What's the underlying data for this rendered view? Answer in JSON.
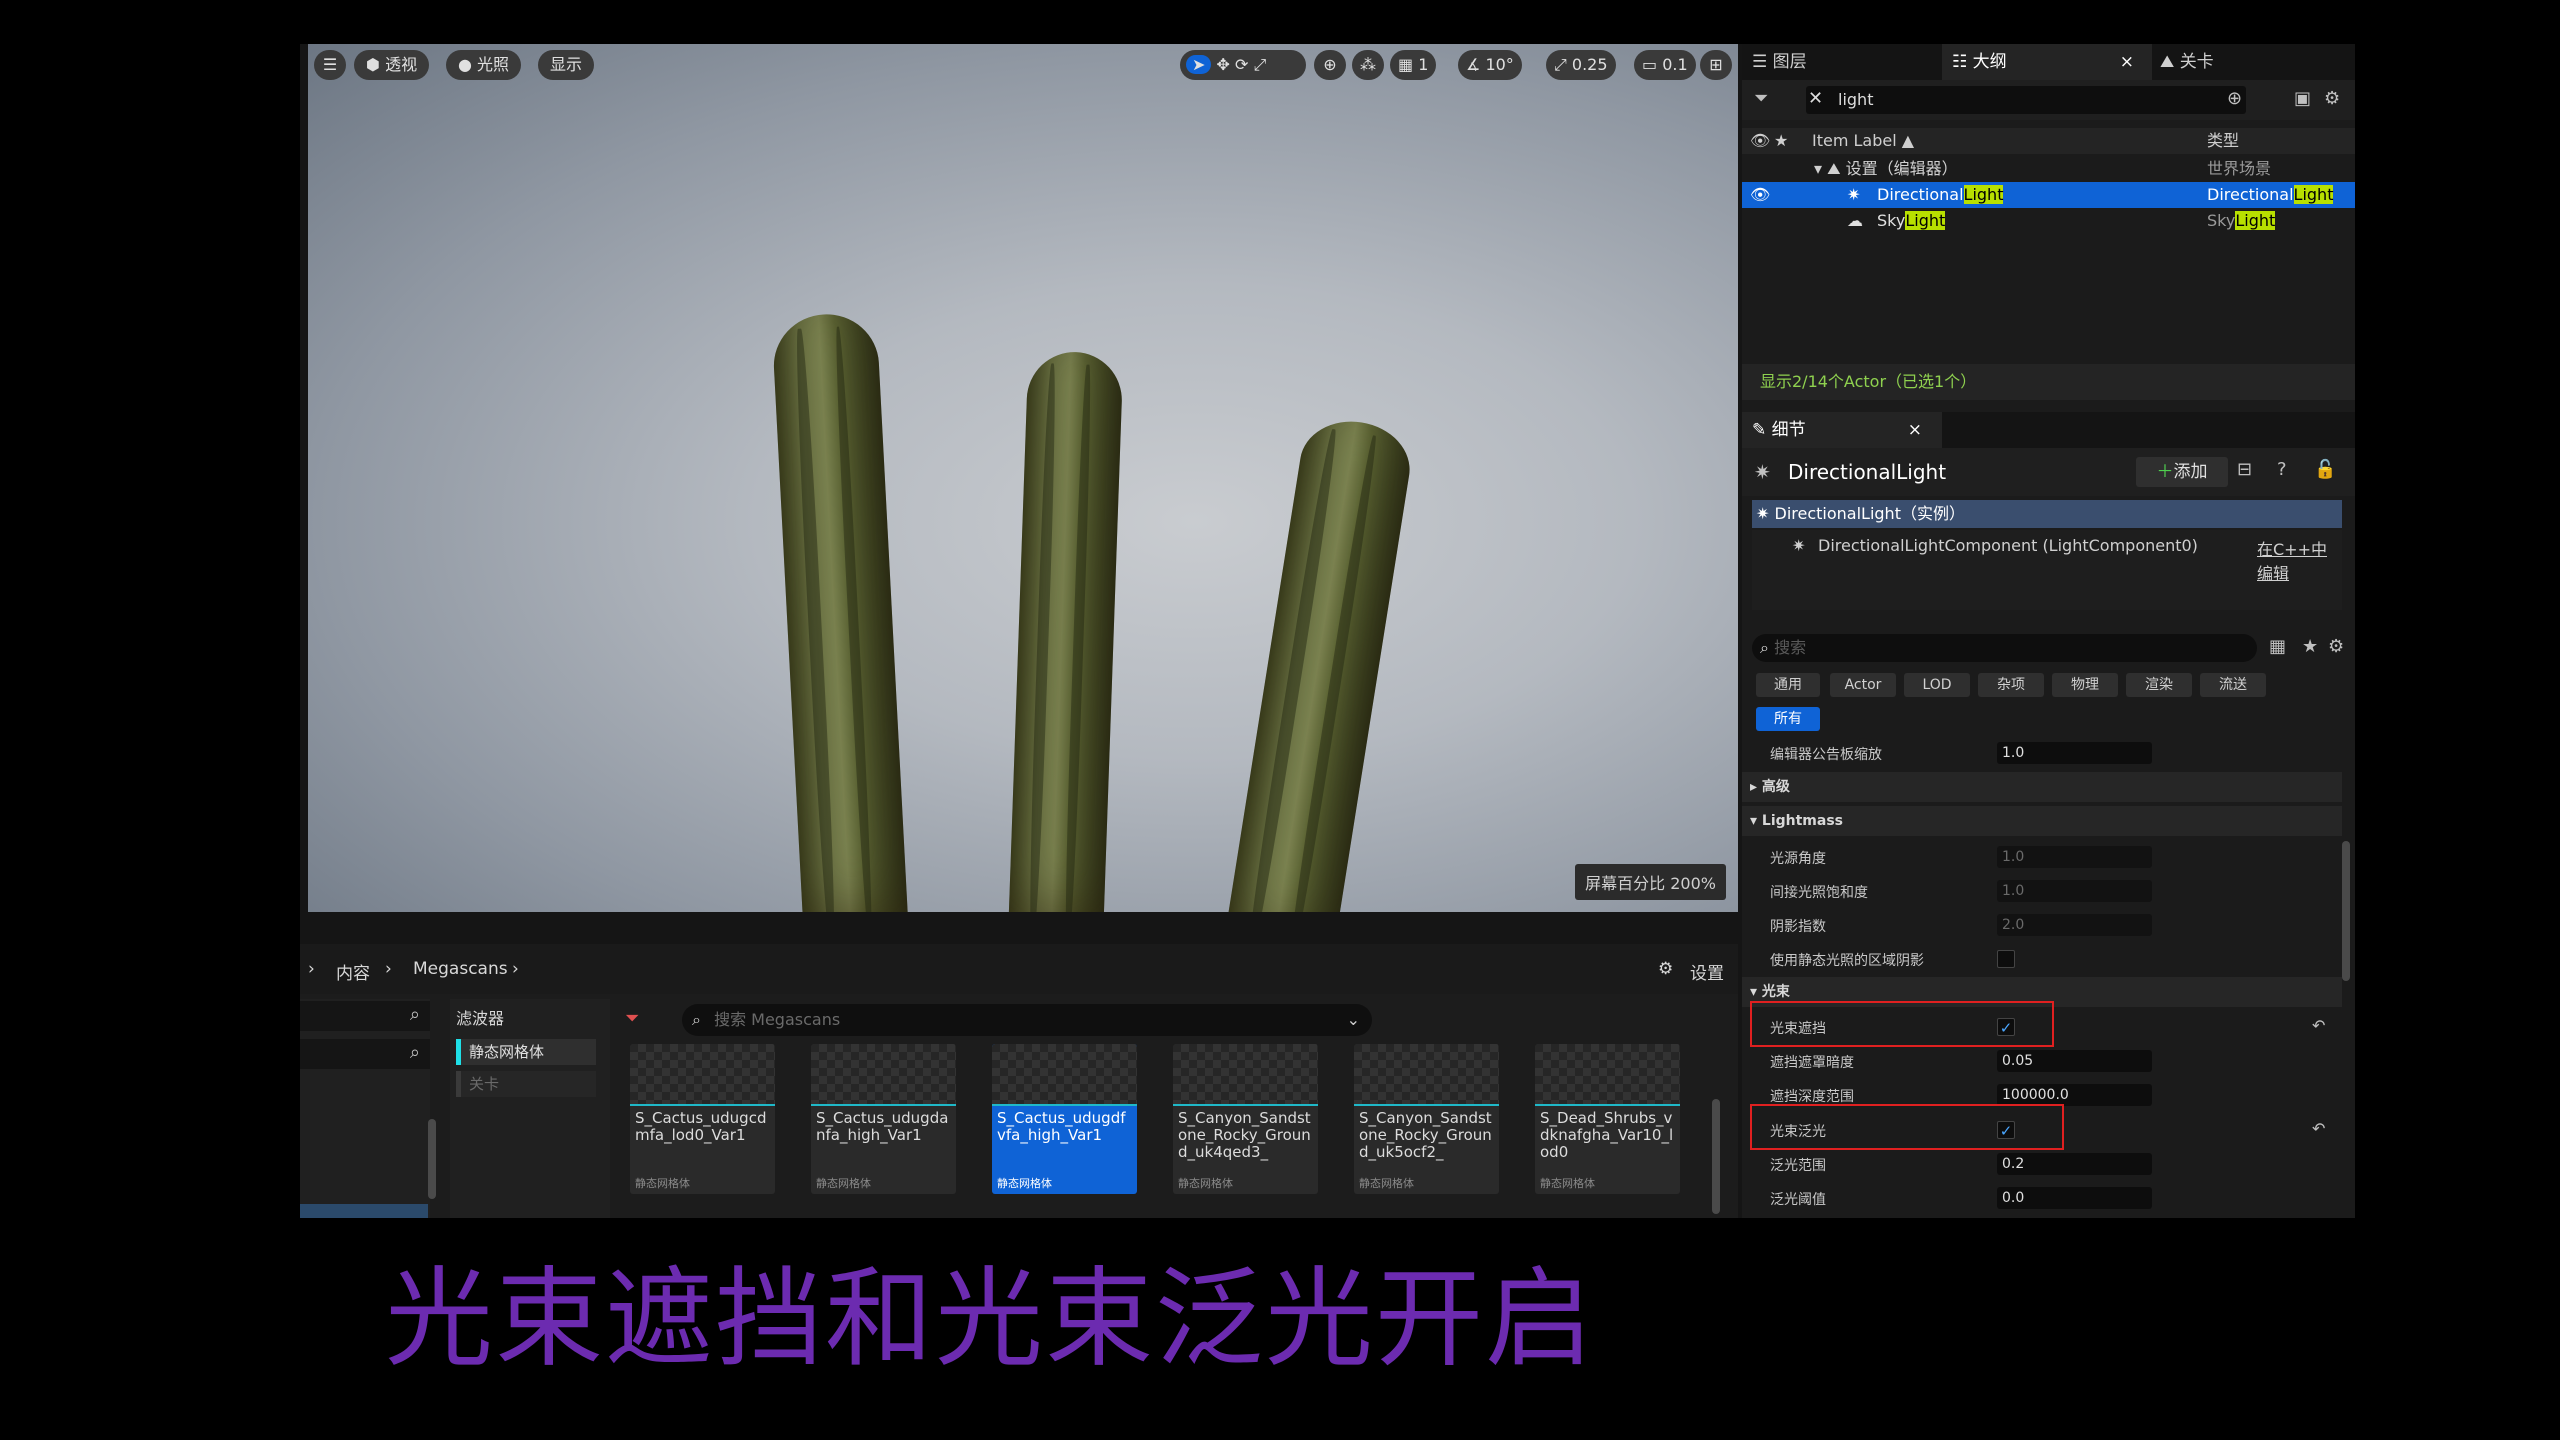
{
  "viewport": {
    "menu_icon": "hamburger-icon",
    "mode_perspective": "透视",
    "mode_lit": "光照",
    "mode_show": "显示",
    "grid_value": "1",
    "angle_value": "10°",
    "scale_value": "0.25",
    "camera_speed": "0.1",
    "screen_percentage": "屏幕百分比 200%"
  },
  "browser": {
    "breadcrumb": [
      "内容",
      "Megascans"
    ],
    "settings_label": "设置",
    "filter_title": "滤波器",
    "filter_items": [
      "静态网格体",
      "关卡"
    ],
    "search_placeholder": "搜索 Megascans",
    "tiles": [
      {
        "name": "S_Cactus_udugcdmfa_lod0_Var1",
        "type": "静态网格体",
        "selected": false
      },
      {
        "name": "S_Cactus_udugdanfa_high_Var1",
        "type": "静态网格体",
        "selected": false
      },
      {
        "name": "S_Cactus_udugdfvfa_high_Var1",
        "type": "静态网格体",
        "selected": true
      },
      {
        "name": "S_Canyon_Sandstone_Rocky_Ground_uk4qed3_",
        "type": "静态网格体",
        "selected": false
      },
      {
        "name": "S_Canyon_Sandstone_Rocky_Ground_uk5ocf2_",
        "type": "静态网格体",
        "selected": false
      },
      {
        "name": "S_Dead_Shrubs_vdknafgha_Var10_lod0",
        "type": "静态网格体",
        "selected": false
      }
    ]
  },
  "outliner": {
    "tabs": [
      "图层",
      "大纲",
      "关卡"
    ],
    "search_value": "light",
    "col_label": "Item Label ▲",
    "col_type": "类型",
    "folder_label": "设置（编辑器）",
    "folder_type": "世界场景",
    "items": [
      {
        "name_pre": "Directional",
        "name_hl": "Light",
        "type_pre": "Directional",
        "type_hl": "Light",
        "selected": true
      },
      {
        "name_pre": "Sky",
        "name_hl": "Light",
        "type_pre": "Sky",
        "type_hl": "Light",
        "selected": false
      }
    ],
    "status": "显示2/14个Actor（已选1个）"
  },
  "details": {
    "tab": "细节",
    "actor_name": "DirectionalLight",
    "add_label": "添加",
    "instance_label": "DirectionalLight（实例）",
    "component_label": "DirectionalLightComponent (LightComponent0)",
    "edit_cpp": "在C++中编辑",
    "search_placeholder": "搜索",
    "filters": [
      "通用",
      "Actor",
      "LOD",
      "杂项",
      "物理",
      "渲染",
      "流送",
      "所有"
    ],
    "props_top": [
      {
        "label": "编辑器公告板缩放",
        "value": "1.0"
      }
    ],
    "advanced": "高级",
    "lightmass": "Lightmass",
    "lightmass_props": [
      {
        "label": "光源角度",
        "value": "1.0"
      },
      {
        "label": "间接光照饱和度",
        "value": "1.0"
      },
      {
        "label": "阴影指数",
        "value": "2.0"
      },
      {
        "label": "使用静态光照的区域阴影",
        "value": ""
      }
    ],
    "lightshaft": "光束",
    "lightshaft_props": [
      {
        "label": "光束遮挡",
        "value": "✓"
      },
      {
        "label": "遮挡遮罩暗度",
        "value": "0.05"
      },
      {
        "label": "遮挡深度范围",
        "value": "100000.0"
      },
      {
        "label": "光束泛光",
        "value": "✓"
      },
      {
        "label": "泛光范围",
        "value": "0.2"
      },
      {
        "label": "泛光阈值",
        "value": "0.0"
      }
    ]
  },
  "caption": "光束遮挡和光束泛光开启",
  "colors": {
    "accent": "#0f63d6",
    "highlight": "#b8e000",
    "caption": "#6c2bb0",
    "annotation": "#e02020"
  }
}
